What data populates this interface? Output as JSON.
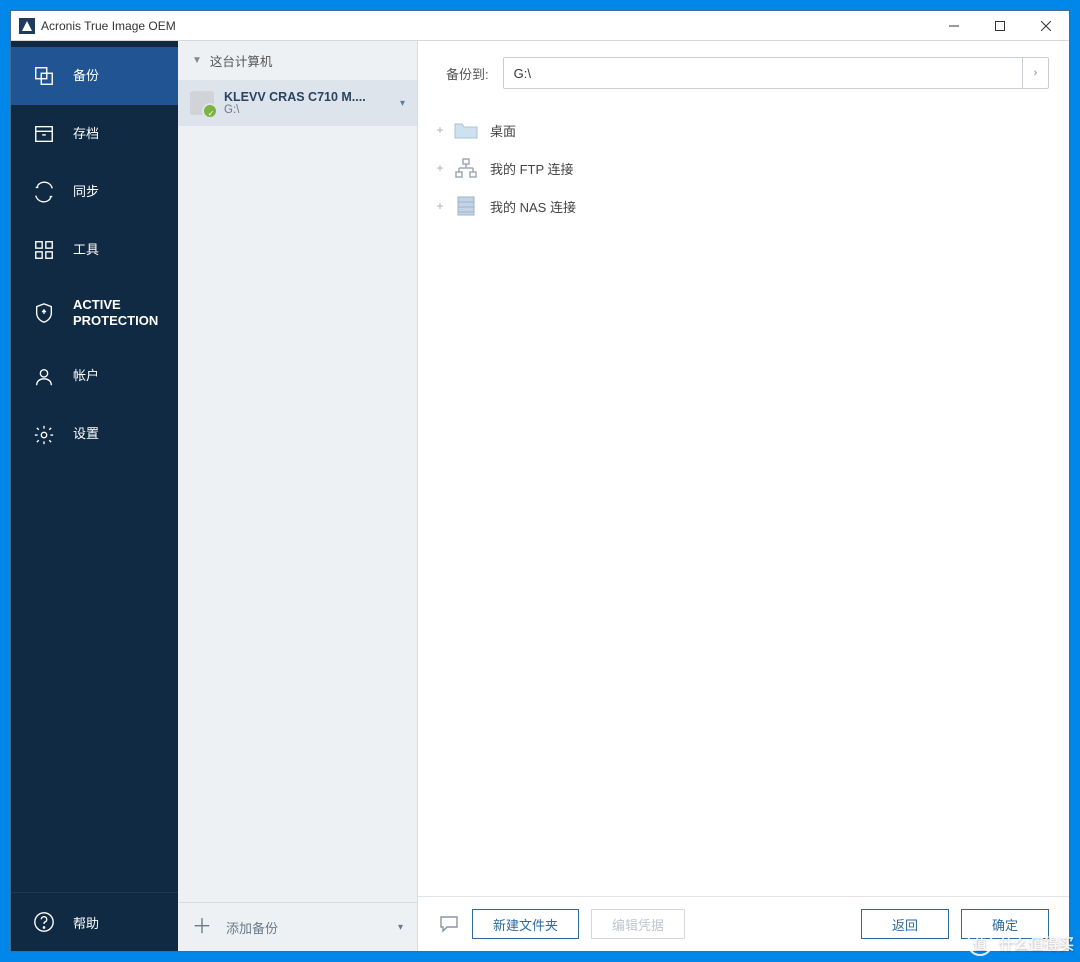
{
  "window": {
    "title": "Acronis True Image OEM"
  },
  "sidebar": {
    "items": [
      {
        "label": "备份"
      },
      {
        "label": "存档"
      },
      {
        "label": "同步"
      },
      {
        "label": "工具"
      },
      {
        "label": "ACTIVE\nPROTECTION"
      },
      {
        "label": "帐户"
      },
      {
        "label": "设置"
      }
    ],
    "help_label": "帮助"
  },
  "list_panel": {
    "header": "这台计算机",
    "item": {
      "name": "KLEVV CRAS C710 M....",
      "sub": "G:\\"
    },
    "add_backup_label": "添加备份"
  },
  "main": {
    "path_label": "备份到:",
    "path_value": "G:\\",
    "tree": [
      {
        "label": "桌面"
      },
      {
        "label": "我的 FTP 连接"
      },
      {
        "label": "我的 NAS 连接"
      }
    ],
    "buttons": {
      "new_folder": "新建文件夹",
      "edit_creds": "编辑凭据",
      "back": "返回",
      "ok": "确定"
    }
  },
  "watermark": "什么值得买"
}
